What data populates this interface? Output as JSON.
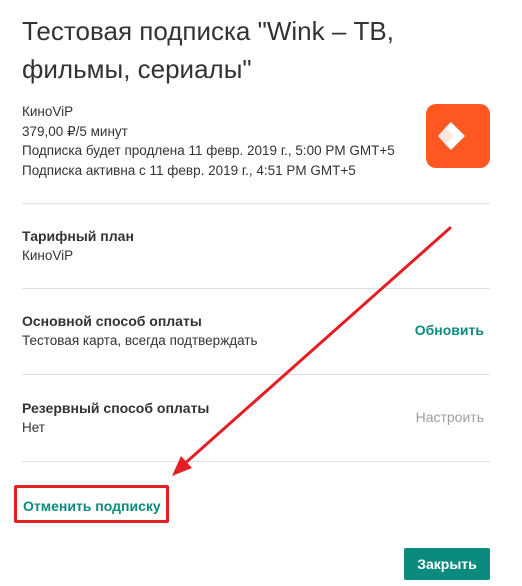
{
  "dialog": {
    "title": "Тестовая подписка \"Wink – ТВ, фильмы, сериалы\""
  },
  "subscription": {
    "name": "КиноViP",
    "price": "379,00 ₽/5 минут",
    "renewal": "Подписка будет продлена 11 февр. 2019 г., 5:00 PM GMT+5",
    "active_since": "Подписка активна с 11 февр. 2019 г., 4:51 PM GMT+5",
    "icon": "wink-app-icon",
    "icon_color": "#ff5722"
  },
  "tariff": {
    "title": "Тарифный план",
    "value": "КиноViP"
  },
  "primary_payment": {
    "title": "Основной способ оплаты",
    "value": "Тестовая карта, всегда подтверждать",
    "action_label": "Обновить"
  },
  "backup_payment": {
    "title": "Резервный способ оплаты",
    "value": "Нет",
    "action_label": "Настроить"
  },
  "cancel": {
    "label": "Отменить подписку"
  },
  "footer": {
    "close_label": "Закрыть"
  },
  "colors": {
    "accent": "#0b8a7e",
    "annotation": "#e31e24"
  }
}
